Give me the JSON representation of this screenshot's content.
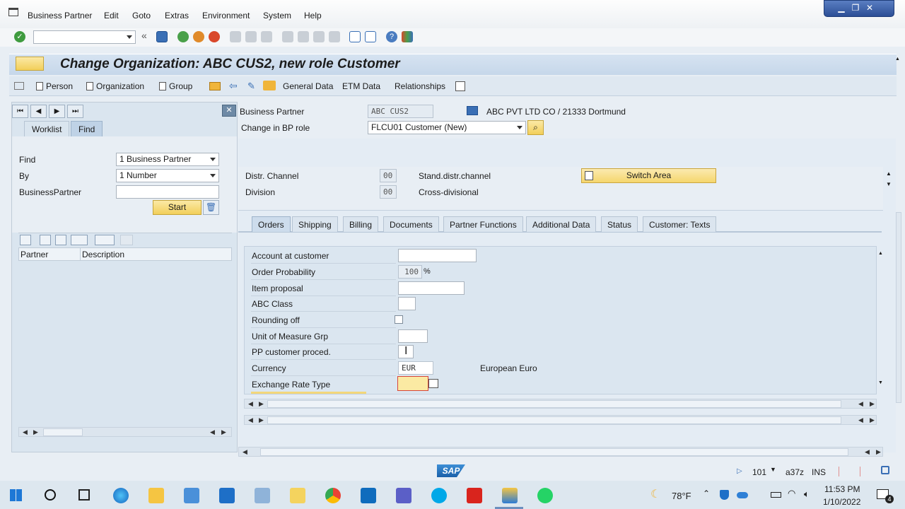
{
  "menu": {
    "business_partner": "Business Partner",
    "edit": "Edit",
    "goto": "Goto",
    "extras": "Extras",
    "environment": "Environment",
    "system": "System",
    "help": "Help"
  },
  "title": "Change Organization: ABC CUS2, new role Customer",
  "appbar": {
    "person": "Person",
    "organization": "Organization",
    "group": "Group",
    "general_data": "General Data",
    "etm_data": "ETM Data",
    "relationships": "Relationships"
  },
  "left": {
    "tab_worklist": "Worklist",
    "tab_find": "Find",
    "find_label": "Find",
    "find_value": "1 Business Partner",
    "by_label": "By",
    "by_value": "1 Number",
    "bp_label": "BusinessPartner",
    "bp_value": "",
    "start": "Start",
    "col_partner": "Partner",
    "col_description": "Description"
  },
  "header": {
    "bp_label": "Business Partner",
    "bp_value": "ABC CUS2",
    "bp_desc": "ABC PVT LTD CO / 21333 Dortmund",
    "role_label": "Change in BP role",
    "role_value": "FLCU01 Customer (New)"
  },
  "area": {
    "distr_label": "Distr. Channel",
    "distr_value": "00",
    "distr_desc": "Stand.distr.channel",
    "division_label": "Division",
    "division_value": "00",
    "division_desc": "Cross-divisional",
    "switch_area": "Switch Area"
  },
  "tabs": [
    "Orders",
    "Shipping",
    "Billing",
    "Documents",
    "Partner Functions",
    "Additional Data",
    "Status",
    "Customer: Texts"
  ],
  "orders": {
    "account_label": "Account at customer",
    "account_value": "",
    "prob_label": "Order Probability",
    "prob_value": "100",
    "prob_unit": "%",
    "item_label": "Item proposal",
    "item_value": "",
    "abc_label": "ABC Class",
    "abc_value": "",
    "rounding_label": "Rounding off",
    "uom_label": "Unit of Measure Grp",
    "uom_value": "",
    "pp_label": "PP customer proced.",
    "pp_value": "",
    "currency_label": "Currency",
    "currency_value": "EUR",
    "currency_desc": "European Euro",
    "exch_label": "Exchange Rate Type",
    "exch_value": ""
  },
  "status": {
    "sap_logo": "SAP",
    "client": "101",
    "server": "a37z",
    "mode": "INS"
  },
  "taskbar": {
    "weather": "78°F",
    "time": "11:53 PM",
    "date": "1/10/2022",
    "notifications": "4"
  },
  "colors": {
    "accent_yellow": "#f2cf5a",
    "selected_tab": "#cddcec",
    "title_bg": "#c6d7ea"
  }
}
